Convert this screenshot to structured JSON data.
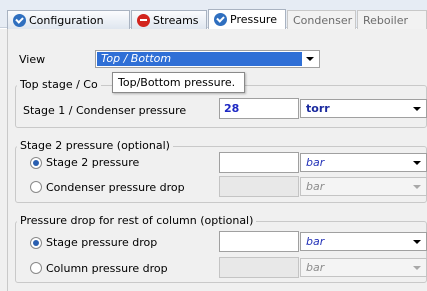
{
  "tabs": [
    {
      "label": "Configuration",
      "icon": "check-circle-icon"
    },
    {
      "label": "Streams",
      "icon": "minus-circle-icon"
    },
    {
      "label": "Pressure",
      "icon": "check-circle-icon"
    },
    {
      "label": "Condenser"
    },
    {
      "label": "Reboiler"
    }
  ],
  "view": {
    "label": "View",
    "value": "Top / Bottom"
  },
  "tooltip": "Top/Bottom pressure.",
  "top_stage": {
    "legend": "Top stage / Co",
    "condenser_label": "Stage 1 / Condenser pressure",
    "condenser_value": "28",
    "condenser_unit": "torr"
  },
  "stage2": {
    "legend": "Stage 2 pressure (optional)",
    "options": [
      {
        "label": "Stage 2 pressure",
        "value": "",
        "unit": "bar",
        "selected": true
      },
      {
        "label": "Condenser pressure drop",
        "value": "",
        "unit": "bar",
        "selected": false
      }
    ]
  },
  "pressure_drop": {
    "legend": "Pressure drop for rest of column (optional)",
    "options": [
      {
        "label": "Stage pressure drop",
        "value": "",
        "unit": "bar",
        "selected": true
      },
      {
        "label": "Column pressure drop",
        "value": "",
        "unit": "bar",
        "selected": false
      }
    ]
  },
  "colors": {
    "accent": "#2f6fbf",
    "error": "#d2241e",
    "value_text": "#1d28c4"
  }
}
